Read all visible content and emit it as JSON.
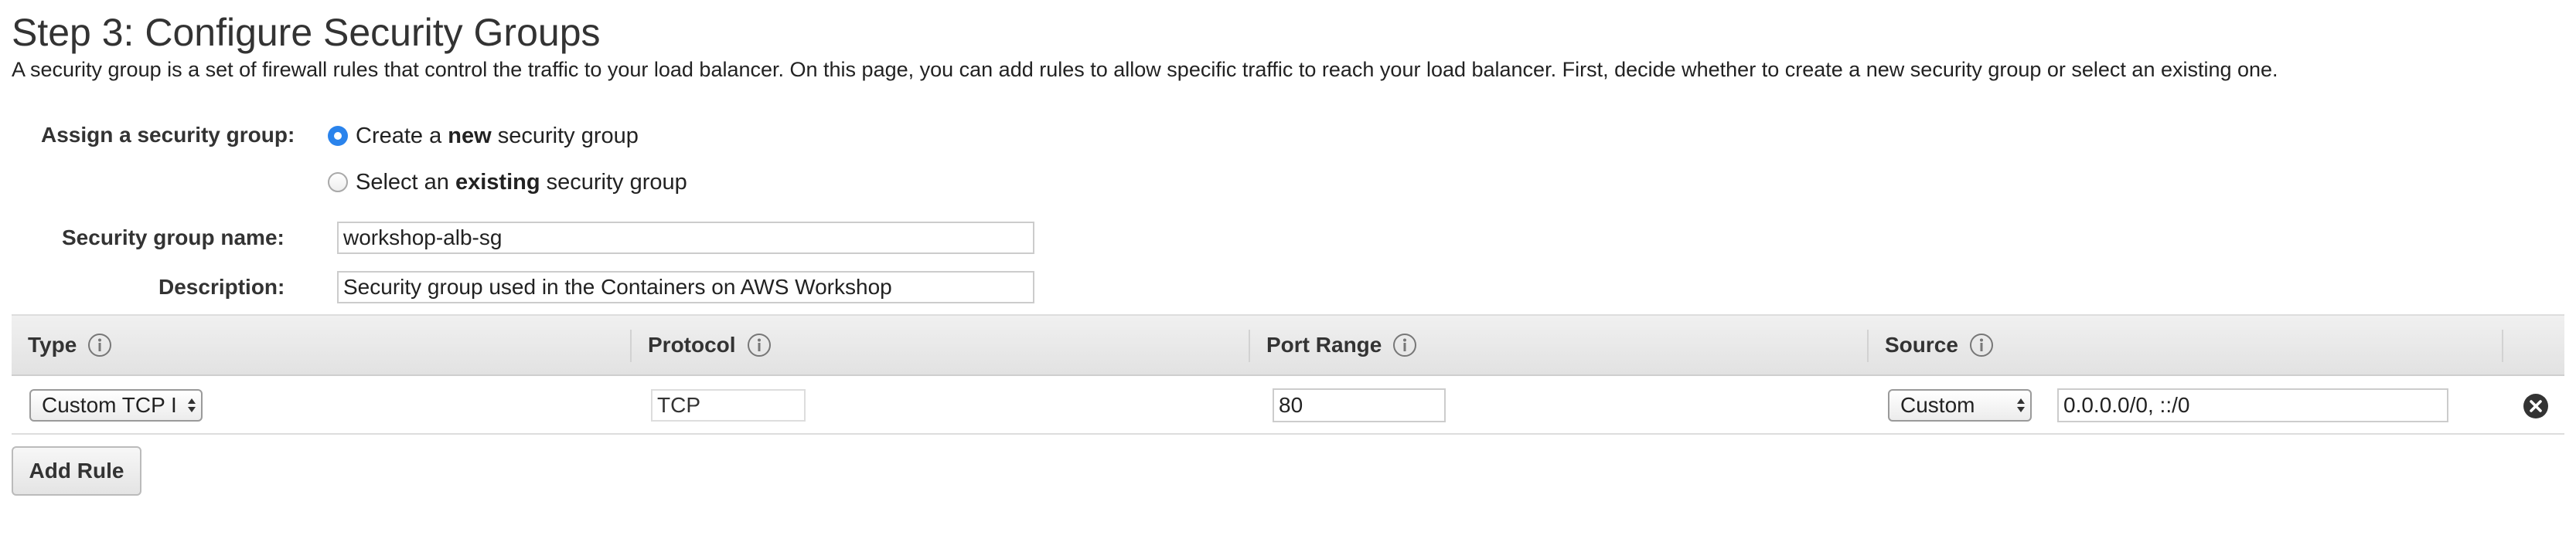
{
  "page": {
    "title": "Step 3: Configure Security Groups",
    "description": "A security group is a set of firewall rules that control the traffic to your load balancer. On this page, you can add rules to allow specific traffic to reach your load balancer. First, decide whether to create a new security group or select an existing one."
  },
  "assign": {
    "label": "Assign a security group:",
    "options": [
      {
        "prefix": "Create a ",
        "bold": "new",
        "suffix": " security group",
        "selected": true
      },
      {
        "prefix": "Select an ",
        "bold": "existing",
        "suffix": " security group",
        "selected": false
      }
    ]
  },
  "name_field": {
    "label": "Security group name:",
    "value": "workshop-alb-sg"
  },
  "description_field": {
    "label": "Description:",
    "value": "Security group used in the Containers on AWS Workshop"
  },
  "rules_table": {
    "columns": [
      {
        "label": "Type",
        "icon": "info-icon"
      },
      {
        "label": "Protocol",
        "icon": "info-icon"
      },
      {
        "label": "Port Range",
        "icon": "info-icon"
      },
      {
        "label": "Source",
        "icon": "info-icon"
      }
    ],
    "rows": [
      {
        "type": "Custom TCP I",
        "protocol": "TCP",
        "port_range": "80",
        "source_type": "Custom",
        "source_value": "0.0.0.0/0, ::/0",
        "remove_icon": "remove-circle-x-icon"
      }
    ]
  },
  "add_rule_label": "Add Rule",
  "colors": {
    "radio_selected": "#2a83ec",
    "header_bg": "#e8e8e8",
    "text": "#333333"
  }
}
